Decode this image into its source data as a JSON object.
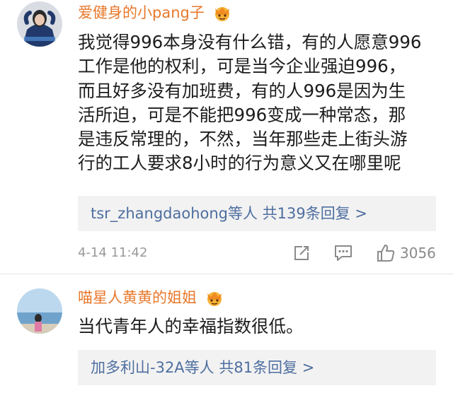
{
  "comments": [
    {
      "username": "爱健身的小pang子",
      "text_lines": [
        "我觉得996本身没有什么错，有的人愿意996",
        "工作是他的权利，可是当今企业强迫996，",
        "而且好多没有加班费，有的人996是因为生",
        "活所迫，可是不能把996变成一种常态，那",
        "是违反常理的，不然，当年那些走上街头游",
        "行的工人要求8小时的行为意义又在哪里呢"
      ],
      "replies": "tsr_zhangdaohong等人 共139条回复 >",
      "timestamp": "4-14 11:42",
      "like_count": "3056",
      "icons": [
        "crown-badge-icon",
        "repost-icon",
        "comment-icon",
        "thumbs-up-icon"
      ]
    },
    {
      "username": "喵星人黄黄的姐姐",
      "text_lines": [
        "当代青年人的幸福指数很低。"
      ],
      "replies": "加多利山-32A等人 共81条回复 >",
      "icons": [
        "crown-badge-icon"
      ]
    }
  ],
  "colors": {
    "username": "#e8782b",
    "link": "#4e6ea0",
    "meta": "#9a9a9a",
    "reply_bg": "#f2f2f2"
  }
}
